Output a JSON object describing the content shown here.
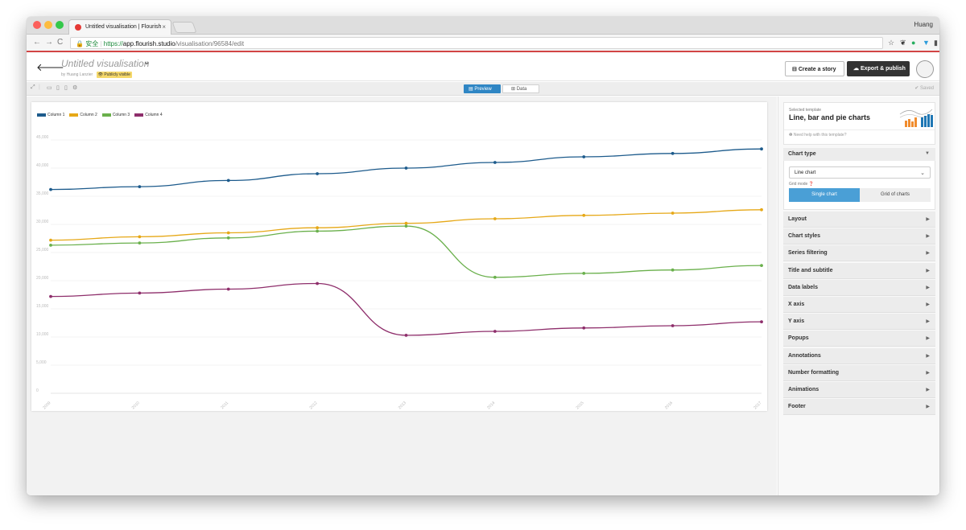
{
  "browser": {
    "tab_title": "Untitled visualisation | Flourish",
    "tab_close": "×",
    "profile_name": "Huang",
    "url_secure": "安全",
    "url_scheme": "https://",
    "url_domain": "app.flourish.studio",
    "url_path": "/visualisation/96584/edit",
    "back": "←",
    "forward": "→",
    "reload": "C"
  },
  "header": {
    "back_arrow": "🡐",
    "title": "Untitled visualisation",
    "chevron": "⌄",
    "byline": "by Huang Lanzier",
    "visibility": "Publicly visible",
    "create_story": "Create a story",
    "export": "Export & publish"
  },
  "toolbar": {
    "preview": "Preview",
    "data": "Data",
    "saved": "Saved"
  },
  "chart_data": {
    "type": "line",
    "x": [
      "2009",
      "2010",
      "2011",
      "2012",
      "2013",
      "2014",
      "2015",
      "2016",
      "2017"
    ],
    "series": [
      {
        "name": "Column 1",
        "color": "#1d5b8c",
        "values": [
          36200,
          36700,
          37800,
          39000,
          40000,
          41000,
          42000,
          42600,
          43400
        ]
      },
      {
        "name": "Column 2",
        "color": "#e6a817",
        "values": [
          27200,
          27800,
          28500,
          29400,
          30200,
          31000,
          31600,
          32000,
          32600
        ]
      },
      {
        "name": "Column 3",
        "color": "#6ab04c",
        "values": [
          26300,
          26700,
          27600,
          28800,
          29700,
          20600,
          21300,
          21900,
          22700
        ]
      },
      {
        "name": "Column 4",
        "color": "#8e2e6b",
        "values": [
          17200,
          17800,
          18500,
          19500,
          10300,
          11000,
          11600,
          12000,
          12700
        ]
      }
    ],
    "yticks": [
      0,
      5000,
      10000,
      15000,
      20000,
      25000,
      30000,
      35000,
      40000,
      45000
    ],
    "ytick_labels": [
      "0",
      "5,000",
      "10,000",
      "15,000",
      "20,000",
      "25,000",
      "30,000",
      "35,000",
      "40,000",
      "45,000"
    ],
    "ylim": [
      0,
      45000
    ],
    "grid": true,
    "legend_position": "top-left"
  },
  "panel": {
    "selected_label": "Selected template",
    "template_name": "Line, bar and pie charts",
    "help": "Need help with this template?",
    "chart_type_header": "Chart type",
    "chart_type_value": "Line chart",
    "grid_mode_label": "Grid mode",
    "seg_single": "Single chart",
    "seg_grid": "Grid of charts",
    "sections": [
      "Layout",
      "Chart styles",
      "Series filtering",
      "Title and subtitle",
      "Data labels",
      "X axis",
      "Y axis",
      "Popups",
      "Annotations",
      "Number formatting",
      "Animations",
      "Footer"
    ]
  },
  "colors": {
    "accent": "#2f86c4",
    "segment_active": "#4a9fd6",
    "export_button": "#333333"
  }
}
